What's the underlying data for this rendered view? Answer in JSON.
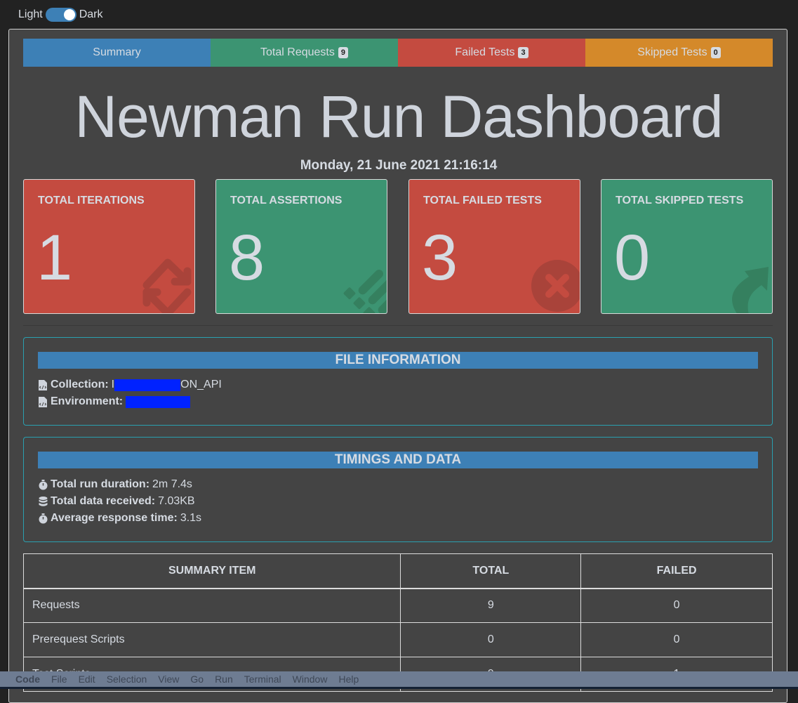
{
  "theme_toggle": {
    "left_label": "Light",
    "right_label": "Dark",
    "state": "dark"
  },
  "tabs": [
    {
      "label": "Summary",
      "badge": null,
      "color": "#3d80b6"
    },
    {
      "label": "Total Requests",
      "badge": "9",
      "color": "#3c9472"
    },
    {
      "label": "Failed Tests",
      "badge": "3",
      "color": "#c44b40"
    },
    {
      "label": "Skipped Tests",
      "badge": "0",
      "color": "#d4892a"
    }
  ],
  "header": {
    "title": "Newman Run Dashboard",
    "date": "Monday, 21 June 2021 21:16:14"
  },
  "cards": [
    {
      "label": "TOTAL ITERATIONS",
      "value": "1",
      "icon": "sync-icon",
      "color": "#c44b40"
    },
    {
      "label": "TOTAL ASSERTIONS",
      "value": "8",
      "icon": "list-icon",
      "color": "#3c9472"
    },
    {
      "label": "TOTAL FAILED TESTS",
      "value": "3",
      "icon": "times-circle-icon",
      "color": "#c44b40"
    },
    {
      "label": "TOTAL SKIPPED TESTS",
      "value": "0",
      "icon": "share-arrow-icon",
      "color": "#3c9472"
    }
  ],
  "file_info": {
    "heading": "FILE INFORMATION",
    "collection_label": "Collection:",
    "collection_prefix": "I",
    "collection_suffix": "ON_API",
    "environment_label": "Environment:"
  },
  "timings": {
    "heading": "TIMINGS AND DATA",
    "items": [
      {
        "icon": "stopwatch-icon",
        "label": "Total run duration:",
        "value": "2m 7.4s"
      },
      {
        "icon": "database-icon",
        "label": "Total data received:",
        "value": "7.03KB"
      },
      {
        "icon": "stopwatch-icon",
        "label": "Average response time:",
        "value": "3.1s"
      }
    ]
  },
  "summary_table": {
    "headers": [
      "SUMMARY ITEM",
      "TOTAL",
      "FAILED"
    ],
    "rows": [
      {
        "item": "Requests",
        "total": "9",
        "failed": "0"
      },
      {
        "item": "Prerequest Scripts",
        "total": "0",
        "failed": "0"
      },
      {
        "item": "Test Scripts",
        "total": "9",
        "failed": "1"
      }
    ]
  },
  "menubar": {
    "app": "Code",
    "items": [
      "File",
      "Edit",
      "Selection",
      "View",
      "Go",
      "Run",
      "Terminal",
      "Window",
      "Help"
    ]
  }
}
